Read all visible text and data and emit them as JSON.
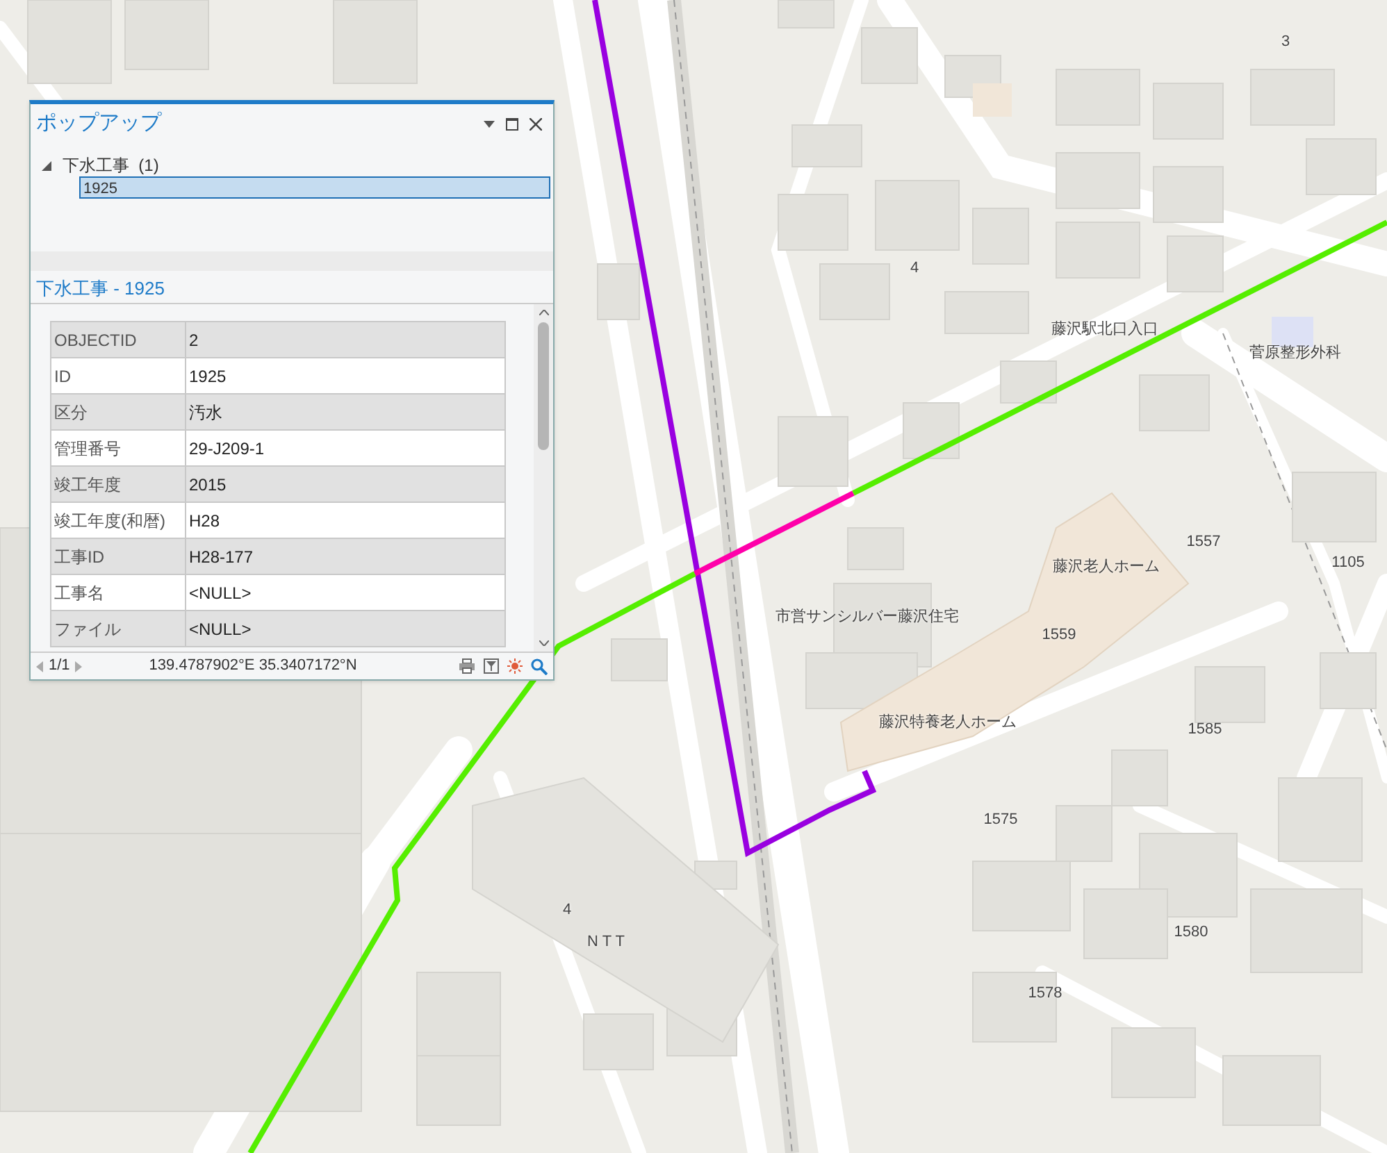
{
  "map": {
    "labels": [
      {
        "text": "3"
      },
      {
        "text": "4"
      },
      {
        "text": "藤沢駅北口入口"
      },
      {
        "text": "菅原整形外科"
      },
      {
        "text": "1557"
      },
      {
        "text": "1105"
      },
      {
        "text": "藤沢老人ホーム"
      },
      {
        "text": "市営サンシルバー藤沢住宅"
      },
      {
        "text": "1559"
      },
      {
        "text": "藤沢特養老人ホーム"
      },
      {
        "text": "1585"
      },
      {
        "text": "1575"
      },
      {
        "text": "1580"
      },
      {
        "text": "1578"
      },
      {
        "text": "4"
      },
      {
        "text": "N T T"
      }
    ],
    "pipes": [
      {
        "color": "#9900e0"
      },
      {
        "color": "#55ee00"
      },
      {
        "color": "#ff00aa"
      },
      {
        "color": "#55ee00"
      }
    ]
  },
  "popup": {
    "title": "ポップアップ",
    "tree": {
      "label": "下水工事  (1)",
      "expanded": true,
      "children": [
        {
          "label": "1925",
          "selected": true
        }
      ]
    },
    "heading": "下水工事 - 1925",
    "rows": [
      {
        "field": "OBJECTID",
        "value": "2"
      },
      {
        "field": "ID",
        "value": "1925"
      },
      {
        "field": "区分",
        "value": "汚水"
      },
      {
        "field": "管理番号",
        "value": "29-J209-1"
      },
      {
        "field": "竣工年度",
        "value": "2015"
      },
      {
        "field": "竣工年度(和暦)",
        "value": "H28"
      },
      {
        "field": "工事ID",
        "value": "H28-177"
      },
      {
        "field": "工事名",
        "value": "<NULL>"
      },
      {
        "field": "ファイル",
        "value": "<NULL>"
      }
    ],
    "pager": "1/1",
    "coordinates": "139.4787902°E 35.3407172°N"
  }
}
